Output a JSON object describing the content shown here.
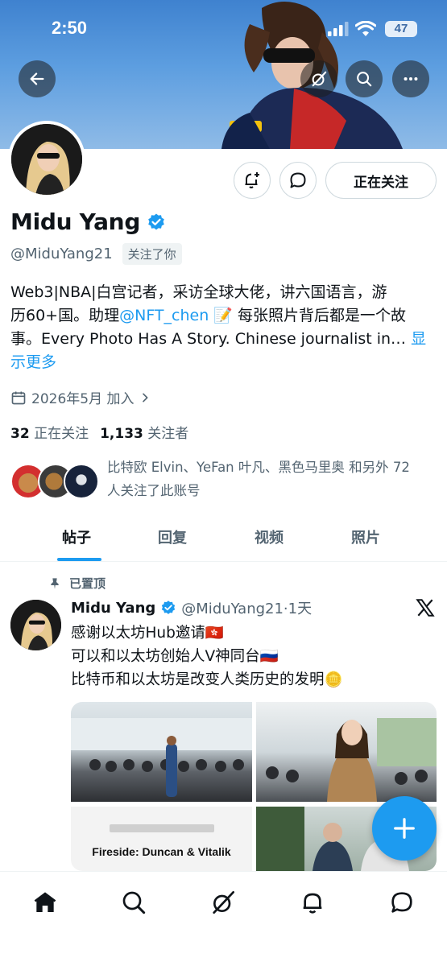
{
  "status_bar": {
    "time": "2:50",
    "battery": "47"
  },
  "profile": {
    "name": "Midu Yang",
    "handle": "@MiduYang21",
    "follows_you": "关注了你",
    "bio_line1": "Web3|NBA|白宫记者，采访全球大佬，讲六国语言，游",
    "bio_line2a": "历60+国。助理",
    "bio_mention": "@NFT_chen",
    "bio_line2b": " 每张照片背后都是一个故",
    "bio_line3": "事。Every Photo Has A Story. Chinese journalist in…",
    "show_more_1": " 显",
    "show_more_2": "示更多",
    "joined": "2026年5月 加入",
    "following_count": "32",
    "following_label": "正在关注",
    "followers_count": "1,133",
    "followers_label": "关注者",
    "followers_you_know_line1": "比特欧 Elvin、YeFan 叶凡、黑色马里奥 和另外 72",
    "followers_you_know_line2": "人关注了此账号"
  },
  "actions": {
    "following_button": "正在关注"
  },
  "tabs": [
    {
      "label": "帖子",
      "active": true
    },
    {
      "label": "回复",
      "active": false
    },
    {
      "label": "视频",
      "active": false
    },
    {
      "label": "照片",
      "active": false
    }
  ],
  "pinned_post": {
    "pinned_label": "已置顶",
    "author": "Midu Yang",
    "handle_time": "@MiduYang21·1天",
    "line1": "感谢以太坊Hub邀请🇭🇰",
    "line2": "可以和以太坊创始人V神同台🇷🇺",
    "line3": "比特币和以太坊是改变人类历史的发明",
    "line3_emoji": "🪙",
    "image3_caption": "Fireside: Duncan & Vitalik"
  },
  "icons": {
    "back": "back-arrow-icon",
    "grok": "grok-icon",
    "search": "search-icon",
    "more": "more-icon",
    "notify": "bell-plus-icon",
    "message": "message-icon",
    "verified": "verified-badge-icon",
    "calendar": "calendar-icon",
    "pin": "pin-icon",
    "x": "x-logo-icon",
    "compose": "plus-icon",
    "nav": [
      "home-icon",
      "search-icon",
      "grok-icon",
      "notifications-icon",
      "messages-icon"
    ]
  },
  "colors": {
    "accent": "#1d9bf0",
    "text": "#0f1419",
    "muted": "#536471"
  }
}
